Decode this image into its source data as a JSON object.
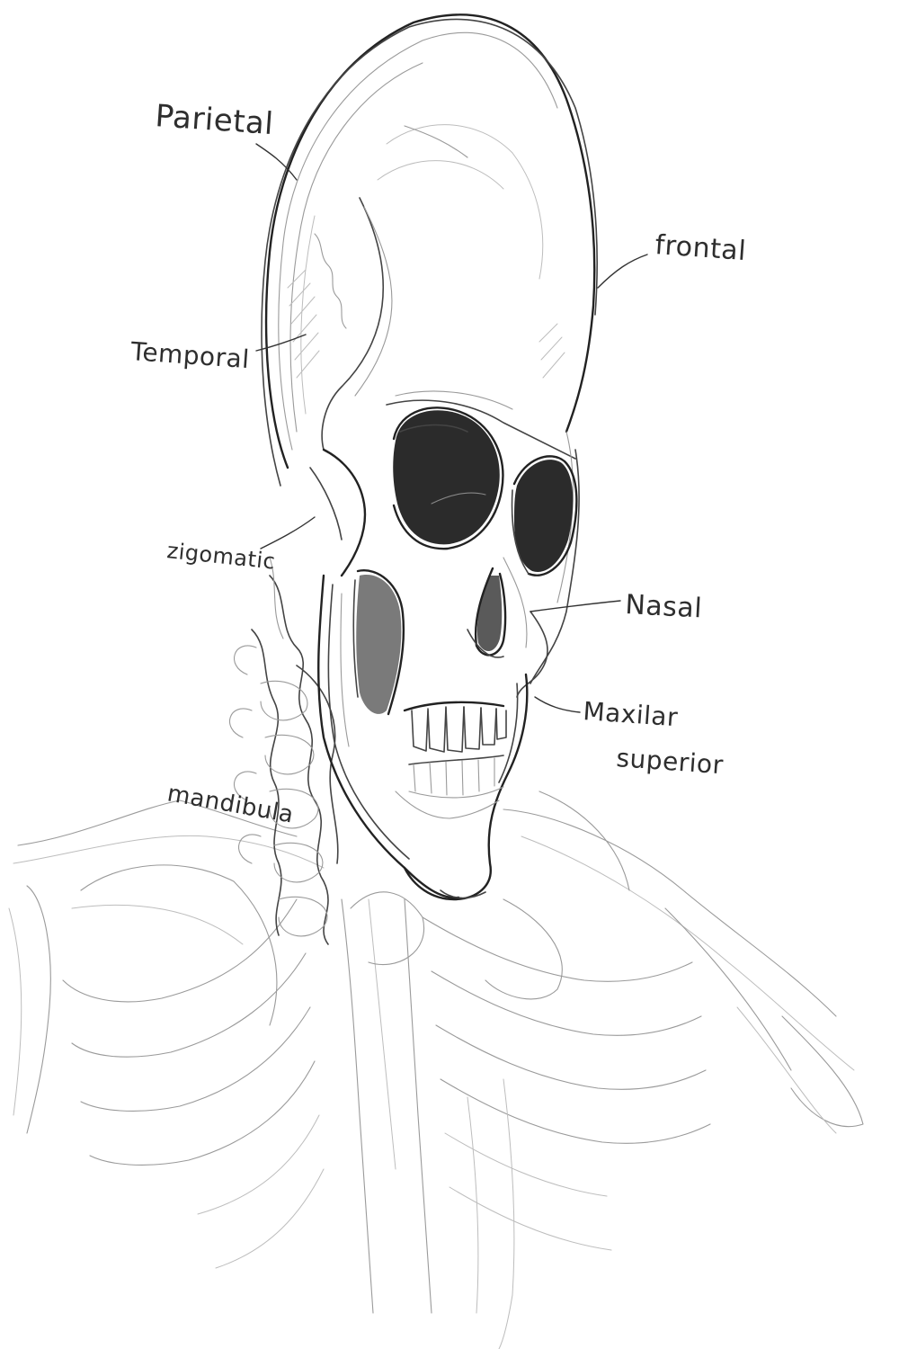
{
  "labels": {
    "parietal": "Parietal",
    "frontal": "frontal",
    "temporal": "Temporal",
    "zigomatico": "zigomatic",
    "nasal": "Nasal",
    "maxilar_line1": "Maxilar",
    "maxilar_line2": "superior",
    "mandibula": "mandibula"
  }
}
